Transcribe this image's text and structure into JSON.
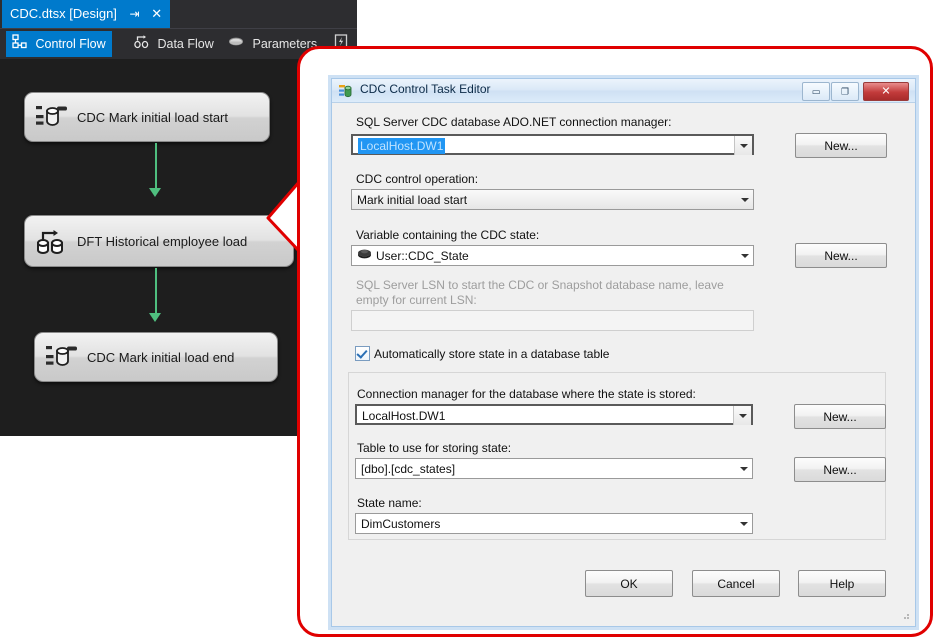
{
  "designer": {
    "tab": {
      "title": "CDC.dtsx [Design]",
      "pin_icon": "pin-icon",
      "close_icon": "close-icon"
    },
    "toolbar": [
      {
        "label": "Control Flow",
        "icon": "control-flow-icon",
        "selected": true
      },
      {
        "label": "Data Flow",
        "icon": "data-flow-icon",
        "selected": false
      },
      {
        "label": "Parameters",
        "icon": "parameters-icon",
        "selected": false
      },
      {
        "label": "",
        "icon": "event-handlers-icon",
        "selected": false
      }
    ],
    "nodes": [
      {
        "label": "CDC Mark initial load start",
        "icon": "cdc-control-task-icon"
      },
      {
        "label": "DFT Historical employee load",
        "icon": "data-flow-task-icon"
      },
      {
        "label": "CDC Mark initial load end",
        "icon": "cdc-control-task-icon"
      }
    ],
    "connector_color": "#4fbf7f",
    "canvas_color": "#1e1e1e"
  },
  "callout": {
    "color": "#e00000"
  },
  "dialog": {
    "title": "CDC Control Task Editor",
    "icon": "cdc-task-icon",
    "window_buttons": {
      "minimize": "minimize-icon",
      "maximize": "maximize-icon",
      "close": "close-icon"
    },
    "fields": {
      "connection_manager": {
        "label": "SQL Server CDC database ADO.NET connection manager:",
        "value": "LocalHost.DW1",
        "new_button": "New..."
      },
      "control_operation": {
        "label": "CDC control operation:",
        "value": "Mark initial load start"
      },
      "state_variable": {
        "label": "Variable containing the CDC state:",
        "value": "User::CDC_State",
        "icon": "variable-icon",
        "new_button": "New..."
      },
      "lsn": {
        "label": "SQL Server LSN to start the CDC or Snapshot database name, leave empty for current LSN:",
        "value": "",
        "disabled": true
      },
      "auto_store": {
        "label": "Automatically store state in a database table",
        "checked": true
      }
    },
    "group": {
      "state_connection": {
        "label": "Connection manager for the database where the state is stored:",
        "value": "LocalHost.DW1",
        "new_button": "New..."
      },
      "state_table": {
        "label": "Table to use for storing state:",
        "value": "[dbo].[cdc_states]",
        "new_button": "New..."
      },
      "state_name": {
        "label": "State name:",
        "value": "DimCustomers"
      }
    },
    "buttons": {
      "ok": "OK",
      "cancel": "Cancel",
      "help": "Help"
    }
  }
}
